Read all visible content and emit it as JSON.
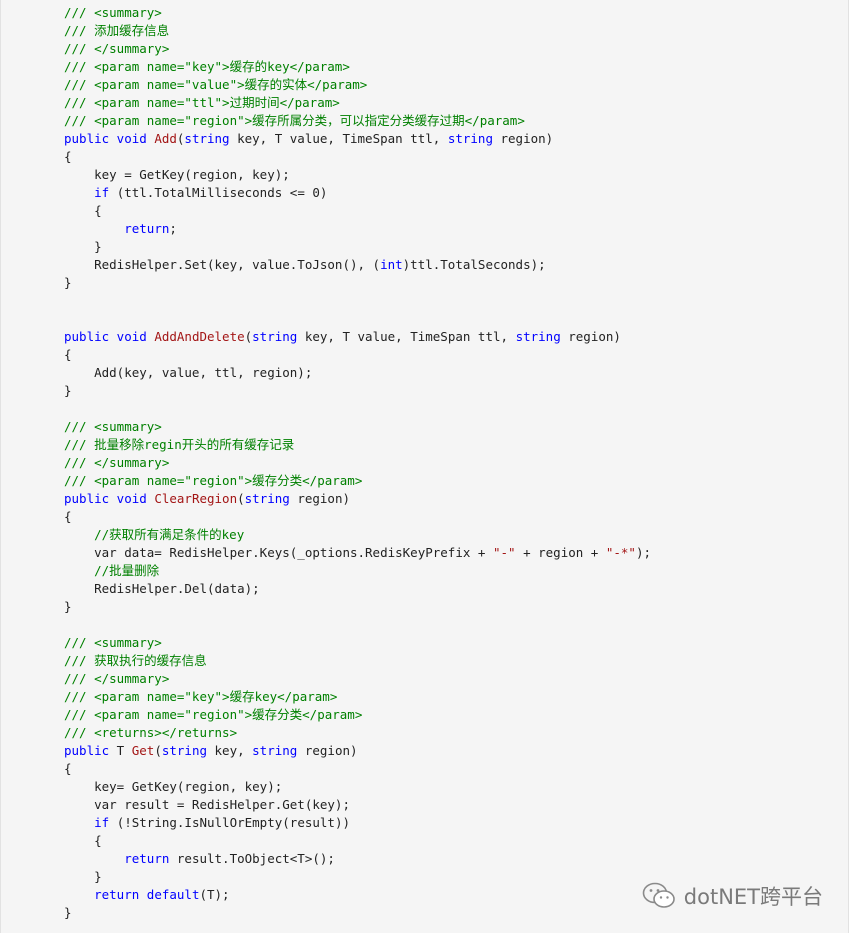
{
  "code": {
    "lines": [
      [
        {
          "t": "/// <summary>",
          "c": "c"
        }
      ],
      [
        {
          "t": "/// 添加缓存信息",
          "c": "c"
        }
      ],
      [
        {
          "t": "/// </summary>",
          "c": "c"
        }
      ],
      [
        {
          "t": "/// <param name=\"key\">缓存的key</param>",
          "c": "c"
        }
      ],
      [
        {
          "t": "/// <param name=\"value\">缓存的实体</param>",
          "c": "c"
        }
      ],
      [
        {
          "t": "/// <param name=\"ttl\">过期时间</param>",
          "c": "c"
        }
      ],
      [
        {
          "t": "/// <param name=\"region\">缓存所属分类，可以指定分类缓存过期</param>",
          "c": "c"
        }
      ],
      [
        {
          "t": "public void ",
          "c": "kw"
        },
        {
          "t": "Add",
          "c": "fn"
        },
        {
          "t": "(",
          "c": ""
        },
        {
          "t": "string",
          "c": "kw"
        },
        {
          "t": " key, T value, TimeSpan ttl, ",
          "c": ""
        },
        {
          "t": "string",
          "c": "kw"
        },
        {
          "t": " region)",
          "c": ""
        }
      ],
      [
        {
          "t": "{",
          "c": ""
        }
      ],
      [
        {
          "t": "    key = GetKey(region, key);",
          "c": ""
        }
      ],
      [
        {
          "t": "    ",
          "c": ""
        },
        {
          "t": "if",
          "c": "kw"
        },
        {
          "t": " (ttl.TotalMilliseconds <= 0)",
          "c": ""
        }
      ],
      [
        {
          "t": "    {",
          "c": ""
        }
      ],
      [
        {
          "t": "        ",
          "c": ""
        },
        {
          "t": "return",
          "c": "kw"
        },
        {
          "t": ";",
          "c": ""
        }
      ],
      [
        {
          "t": "    }",
          "c": ""
        }
      ],
      [
        {
          "t": "    RedisHelper.Set(key, value.ToJson(), (",
          "c": ""
        },
        {
          "t": "int",
          "c": "kw"
        },
        {
          "t": ")ttl.TotalSeconds);",
          "c": ""
        }
      ],
      [
        {
          "t": "}",
          "c": ""
        }
      ],
      [
        {
          "t": "",
          "c": ""
        }
      ],
      [
        {
          "t": "",
          "c": ""
        }
      ],
      [
        {
          "t": "public void ",
          "c": "kw"
        },
        {
          "t": "AddAndDelete",
          "c": "fn"
        },
        {
          "t": "(",
          "c": ""
        },
        {
          "t": "string",
          "c": "kw"
        },
        {
          "t": " key, T value, TimeSpan ttl, ",
          "c": ""
        },
        {
          "t": "string",
          "c": "kw"
        },
        {
          "t": " region)",
          "c": ""
        }
      ],
      [
        {
          "t": "{",
          "c": ""
        }
      ],
      [
        {
          "t": "    Add(key, value, ttl, region);",
          "c": ""
        }
      ],
      [
        {
          "t": "}",
          "c": ""
        }
      ],
      [
        {
          "t": "",
          "c": ""
        }
      ],
      [
        {
          "t": "/// <summary>",
          "c": "c"
        }
      ],
      [
        {
          "t": "/// 批量移除regin开头的所有缓存记录",
          "c": "c"
        }
      ],
      [
        {
          "t": "/// </summary>",
          "c": "c"
        }
      ],
      [
        {
          "t": "/// <param name=\"region\">缓存分类</param>",
          "c": "c"
        }
      ],
      [
        {
          "t": "public void ",
          "c": "kw"
        },
        {
          "t": "ClearRegion",
          "c": "fn"
        },
        {
          "t": "(",
          "c": ""
        },
        {
          "t": "string",
          "c": "kw"
        },
        {
          "t": " region)",
          "c": ""
        }
      ],
      [
        {
          "t": "{",
          "c": ""
        }
      ],
      [
        {
          "t": "    //获取所有满足条件的key",
          "c": "c"
        }
      ],
      [
        {
          "t": "    var data= RedisHelper.Keys(_options.RedisKeyPrefix + ",
          "c": ""
        },
        {
          "t": "\"-\"",
          "c": "st"
        },
        {
          "t": " + region + ",
          "c": ""
        },
        {
          "t": "\"-*\"",
          "c": "st"
        },
        {
          "t": ");",
          "c": ""
        }
      ],
      [
        {
          "t": "    //批量删除",
          "c": "c"
        }
      ],
      [
        {
          "t": "    RedisHelper.Del(data);",
          "c": ""
        }
      ],
      [
        {
          "t": "}",
          "c": ""
        }
      ],
      [
        {
          "t": "",
          "c": ""
        }
      ],
      [
        {
          "t": "/// <summary>",
          "c": "c"
        }
      ],
      [
        {
          "t": "/// 获取执行的缓存信息",
          "c": "c"
        }
      ],
      [
        {
          "t": "/// </summary>",
          "c": "c"
        }
      ],
      [
        {
          "t": "/// <param name=\"key\">缓存key</param>",
          "c": "c"
        }
      ],
      [
        {
          "t": "/// <param name=\"region\">缓存分类</param>",
          "c": "c"
        }
      ],
      [
        {
          "t": "/// <returns></returns>",
          "c": "c"
        }
      ],
      [
        {
          "t": "public",
          "c": "kw"
        },
        {
          "t": " T ",
          "c": ""
        },
        {
          "t": "Get",
          "c": "fn"
        },
        {
          "t": "(",
          "c": ""
        },
        {
          "t": "string",
          "c": "kw"
        },
        {
          "t": " key, ",
          "c": ""
        },
        {
          "t": "string",
          "c": "kw"
        },
        {
          "t": " region)",
          "c": ""
        }
      ],
      [
        {
          "t": "{",
          "c": ""
        }
      ],
      [
        {
          "t": "    key= GetKey(region, key);",
          "c": ""
        }
      ],
      [
        {
          "t": "    var result = RedisHelper.Get(key);",
          "c": ""
        }
      ],
      [
        {
          "t": "    ",
          "c": ""
        },
        {
          "t": "if",
          "c": "kw"
        },
        {
          "t": " (!String.IsNullOrEmpty(result))",
          "c": ""
        }
      ],
      [
        {
          "t": "    {",
          "c": ""
        }
      ],
      [
        {
          "t": "        ",
          "c": ""
        },
        {
          "t": "return",
          "c": "kw"
        },
        {
          "t": " result.ToObject<T>();",
          "c": ""
        }
      ],
      [
        {
          "t": "    }",
          "c": ""
        }
      ],
      [
        {
          "t": "    ",
          "c": ""
        },
        {
          "t": "return",
          "c": "kw"
        },
        {
          "t": " ",
          "c": ""
        },
        {
          "t": "default",
          "c": "kw"
        },
        {
          "t": "(T);",
          "c": ""
        }
      ],
      [
        {
          "t": "}",
          "c": ""
        }
      ]
    ],
    "colors": {
      "comment": "#008000",
      "keyword": "#0000ff",
      "identifier": "#a31515",
      "string": "#a31515",
      "text": "#222222"
    }
  },
  "watermark": {
    "text": "dotNET跨平台",
    "icon": "wechat-icon"
  }
}
